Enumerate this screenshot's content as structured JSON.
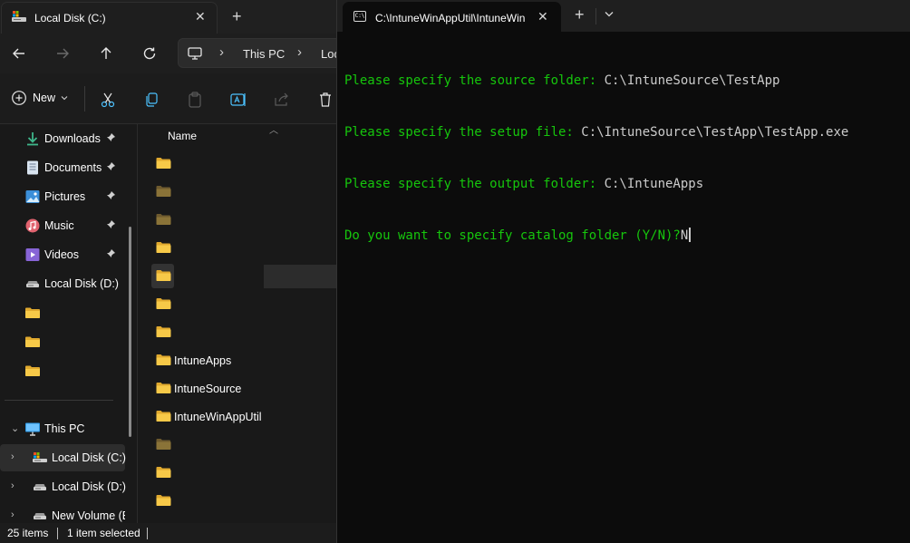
{
  "explorer": {
    "tab_title": "Local Disk (C:)",
    "tab_close": "✕",
    "new_tab": "+",
    "address": {
      "crumb1": "This PC",
      "crumb2": "Local Disk (C:)"
    },
    "new_button": "New",
    "nav": [
      {
        "label": "Downloads",
        "icon": "downloads-icon",
        "pinned": true
      },
      {
        "label": "Documents",
        "icon": "documents-icon",
        "pinned": true
      },
      {
        "label": "Pictures",
        "icon": "pictures-icon",
        "pinned": true
      },
      {
        "label": "Music",
        "icon": "music-icon",
        "pinned": true
      },
      {
        "label": "Videos",
        "icon": "videos-icon",
        "pinned": true
      },
      {
        "label": "Local Disk (D:)",
        "icon": "drive-icon",
        "pinned": false
      },
      {
        "label": "",
        "icon": "folder-icon",
        "pinned": false
      },
      {
        "label": "",
        "icon": "folder-icon",
        "pinned": false
      },
      {
        "label": "",
        "icon": "folder-icon",
        "pinned": false
      }
    ],
    "tree": [
      {
        "label": "This PC",
        "icon": "this-pc-icon",
        "expander": "⌄"
      },
      {
        "label": "Local Disk (C:)",
        "icon": "drive-c-icon",
        "expander": "›"
      },
      {
        "label": "Local Disk (D:)",
        "icon": "drive-icon",
        "expander": "›"
      },
      {
        "label": "New Volume (E:)",
        "icon": "drive-icon",
        "expander": "›"
      }
    ],
    "column_name": "Name",
    "files": [
      {
        "label": "",
        "dim": false
      },
      {
        "label": "",
        "dim": true
      },
      {
        "label": "",
        "dim": true
      },
      {
        "label": "",
        "dim": false
      },
      {
        "label": "",
        "dim": false
      },
      {
        "label": "",
        "dim": false
      },
      {
        "label": "",
        "dim": false
      },
      {
        "label": "IntuneApps",
        "dim": false
      },
      {
        "label": "IntuneSource",
        "dim": false
      },
      {
        "label": "IntuneWinAppUtil",
        "dim": false
      },
      {
        "label": "",
        "dim": true
      },
      {
        "label": "",
        "dim": false
      },
      {
        "label": "",
        "dim": false
      }
    ],
    "status": {
      "items": "25 items",
      "selected": "1 item selected"
    }
  },
  "terminal": {
    "tab_title": "C:\\IntuneWinAppUtil\\IntuneWinAppUtil.exe",
    "tab_close": "✕",
    "new_tab": "+",
    "lines": [
      {
        "prompt": "Please specify the source folder: ",
        "value": "C:\\IntuneSource\\TestApp"
      },
      {
        "prompt": "Please specify the setup file: ",
        "value": "C:\\IntuneSource\\TestApp\\TestApp.exe"
      },
      {
        "prompt": "Please specify the output folder: ",
        "value": "C:\\IntuneApps"
      },
      {
        "prompt": "Do you want to specify catalog folder (Y/N)?",
        "value": "N"
      }
    ]
  },
  "colors": {
    "prompt_green": "#16c60c",
    "folder_yellow": "#f7c948",
    "terminal_bg": "#0c0c0c",
    "explorer_bg": "#191919"
  }
}
